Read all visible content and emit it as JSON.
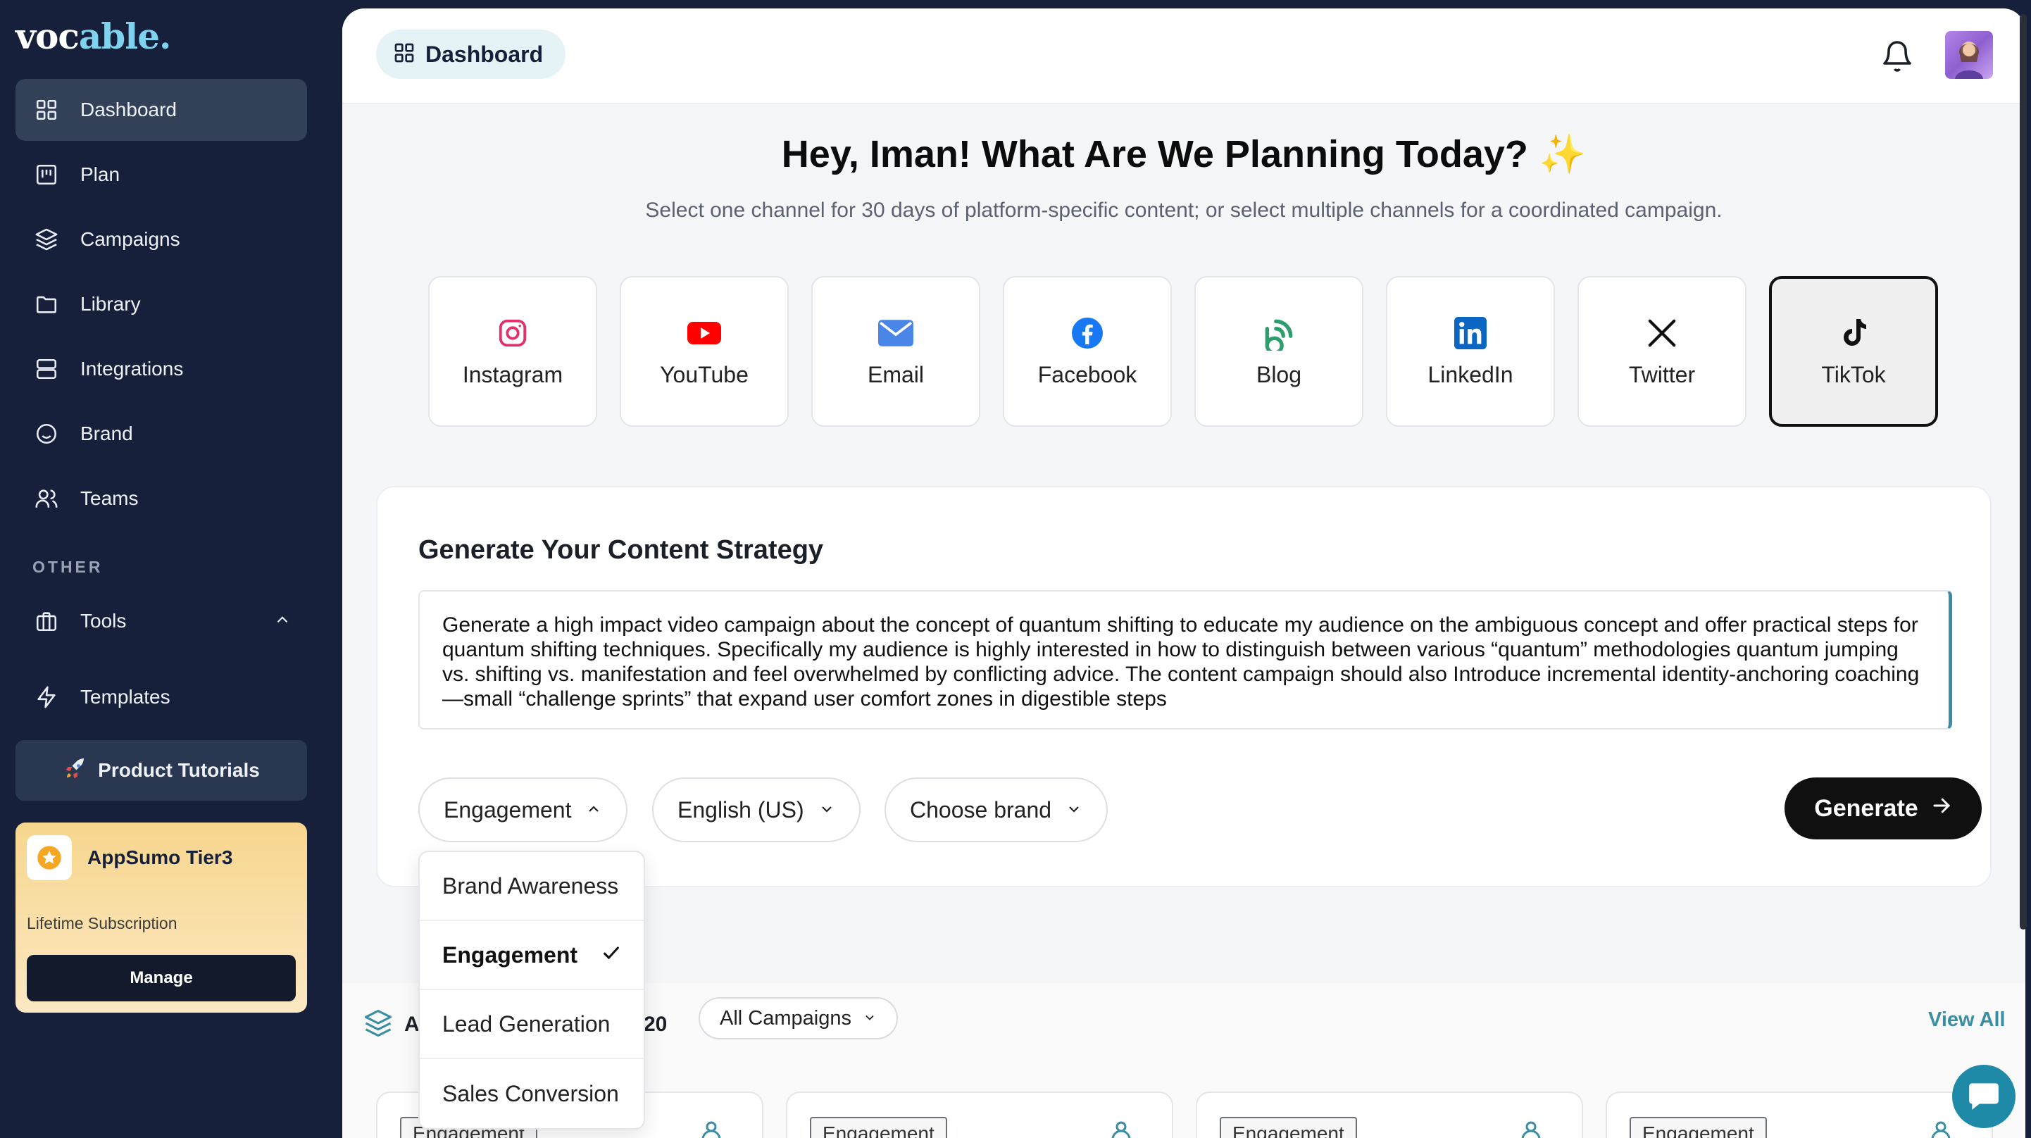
{
  "app": {
    "logo_main": "voc",
    "logo_accent": "able",
    "logo_dot": "."
  },
  "sidebar": {
    "items": [
      {
        "label": "Dashboard",
        "icon": "grid-icon",
        "active": true
      },
      {
        "label": "Plan",
        "icon": "kanban-icon"
      },
      {
        "label": "Campaigns",
        "icon": "layers-icon"
      },
      {
        "label": "Library",
        "icon": "folder-icon"
      },
      {
        "label": "Integrations",
        "icon": "server-icon"
      },
      {
        "label": "Brand",
        "icon": "smile-icon"
      },
      {
        "label": "Teams",
        "icon": "users-icon"
      }
    ],
    "section_label": "OTHER",
    "tools_label": "Tools",
    "templates_label": "Templates",
    "tutorials_label": "Product Tutorials",
    "plan_card": {
      "title": "AppSumo Tier3",
      "subtitle": "Lifetime Subscription",
      "button": "Manage"
    }
  },
  "header": {
    "breadcrumb": "Dashboard"
  },
  "hero": {
    "title": "Hey, Iman! What Are We Planning Today?",
    "title_emoji": "✨",
    "subtitle": "Select one channel for 30 days of platform-specific content; or select multiple channels for a coordinated campaign."
  },
  "channels": [
    {
      "label": "Instagram",
      "icon": "instagram-icon",
      "color": "#e1306c"
    },
    {
      "label": "YouTube",
      "icon": "youtube-icon",
      "color": "#ff0000"
    },
    {
      "label": "Email",
      "icon": "email-icon",
      "color": "#4a86e8"
    },
    {
      "label": "Facebook",
      "icon": "facebook-icon",
      "color": "#1877f2"
    },
    {
      "label": "Blog",
      "icon": "blog-icon",
      "color": "#2f9e6f"
    },
    {
      "label": "LinkedIn",
      "icon": "linkedin-icon",
      "color": "#0a66c2"
    },
    {
      "label": "Twitter",
      "icon": "x-icon",
      "color": "#111111"
    },
    {
      "label": "TikTok",
      "icon": "tiktok-icon",
      "color": "#111111",
      "selected": true
    }
  ],
  "strategy": {
    "title": "Generate Your Content Strategy",
    "prompt": "Generate a high impact video campaign about the concept of quantum shifting to educate my audience on the ambiguous concept and offer practical steps for quantum shifting techniques. Specifically my audience is highly interested in how to distinguish between various “quantum” methodologies quantum jumping vs. shifting vs. manifestation and feel overwhelmed by conflicting advice.  The content campaign should also Introduce incremental identity-anchoring coaching—small “challenge sprints” that expand user comfort zones in digestible steps",
    "goal_selected": "Engagement",
    "language": "English (US)",
    "brand_placeholder": "Choose brand",
    "generate_label": "Generate",
    "goal_options": [
      "Brand Awareness",
      "Engagement",
      "Lead Generation",
      "Sales Conversion"
    ]
  },
  "campaigns": {
    "title_fragment_left": "A",
    "title_fragment_right": "20",
    "filter": "All Campaigns",
    "view_all": "View All",
    "cards": [
      {
        "tag": "Engagement"
      },
      {
        "tag": "Engagement"
      },
      {
        "tag": "Engagement"
      },
      {
        "tag": "Engagement"
      }
    ]
  },
  "colors": {
    "sidebar_bg": "#16203a",
    "accent": "#3a8ea3",
    "active_item": "#334158"
  }
}
